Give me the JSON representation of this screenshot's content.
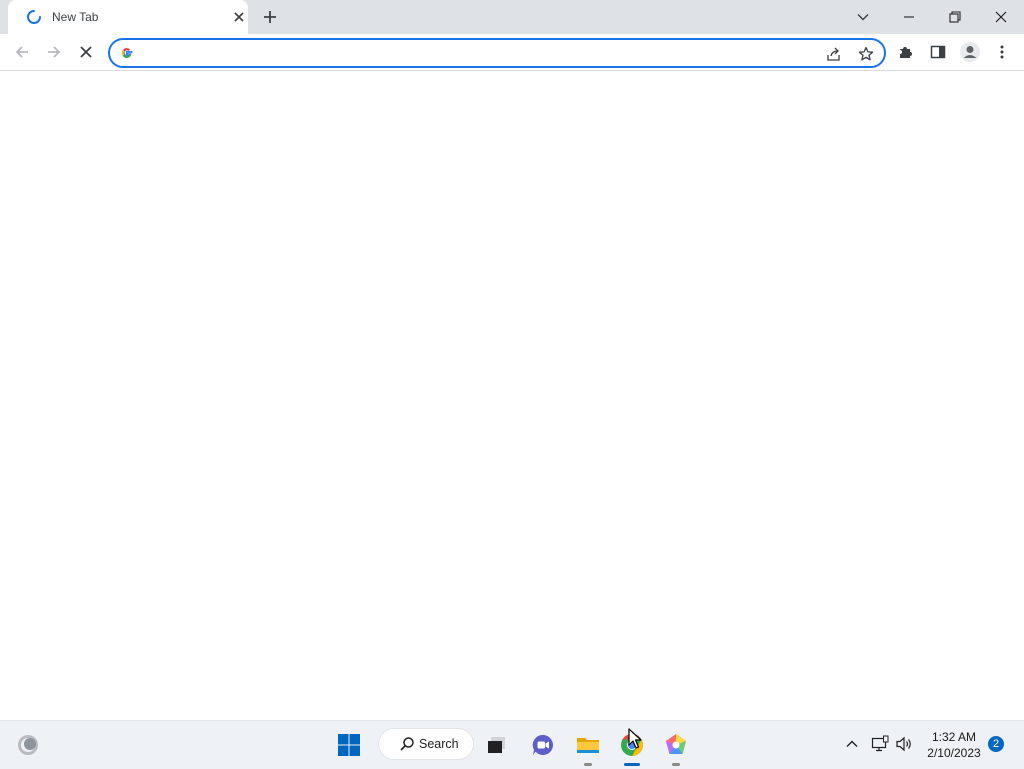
{
  "browser": {
    "tab": {
      "title": "New Tab"
    },
    "omnibox": {
      "value": "",
      "placeholder": ""
    }
  },
  "taskbar": {
    "search_label": "Search",
    "clock": {
      "time": "1:32 AM",
      "date": "2/10/2023"
    },
    "notification_count": "2",
    "apps": [
      "file-explorer",
      "teams-chat",
      "folder",
      "chrome",
      "colorful-app"
    ],
    "active_app": "chrome"
  },
  "colors": {
    "accent": "#1a73e8",
    "tabstrip_bg": "#dee1e6",
    "taskbar_bg": "#eef1f5",
    "windows_blue": "#0067c0"
  }
}
